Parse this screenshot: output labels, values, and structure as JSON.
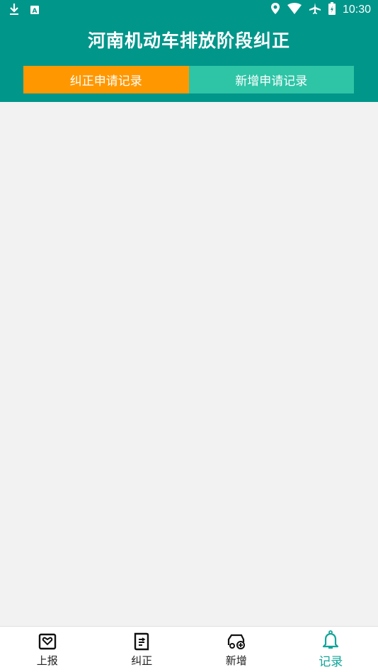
{
  "status_bar": {
    "time": "10:30",
    "icons": [
      "download-icon",
      "keyboard-icon",
      "location-icon",
      "wifi-icon",
      "airplane-icon",
      "battery-icon"
    ]
  },
  "header": {
    "title": "河南机动车排放阶段纠正",
    "background_color": "#00968a"
  },
  "tabs": [
    {
      "label": "纠正申请记录",
      "active": true,
      "color": "#ff9800"
    },
    {
      "label": "新增申请记录",
      "active": false,
      "color": "#2ec4a6"
    }
  ],
  "bottom_nav": [
    {
      "label": "上报",
      "icon": "report-icon",
      "active": false
    },
    {
      "label": "纠正",
      "icon": "correct-icon",
      "active": false
    },
    {
      "label": "新增",
      "icon": "add-vehicle-icon",
      "active": false
    },
    {
      "label": "记录",
      "icon": "bell-icon",
      "active": true
    }
  ],
  "colors": {
    "accent": "#11a59a",
    "content_bg": "#f2f2f2"
  }
}
